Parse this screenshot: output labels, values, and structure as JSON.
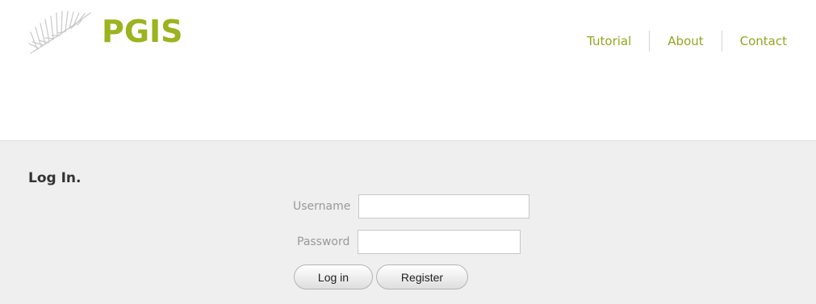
{
  "header": {
    "logo_text": "PGIS",
    "nav": [
      {
        "label": "Tutorial"
      },
      {
        "label": "About"
      },
      {
        "label": "Contact"
      }
    ]
  },
  "login": {
    "title": "Log In.",
    "username_label": "Username",
    "username_value": "",
    "password_label": "Password",
    "password_value": "",
    "login_button": "Log in",
    "register_button": "Register"
  },
  "colors": {
    "brand_green": "#9cb31f",
    "panel_bg": "#efefef",
    "label_gray": "#999999"
  },
  "icons": {
    "logo": "palm-leaf-icon"
  }
}
